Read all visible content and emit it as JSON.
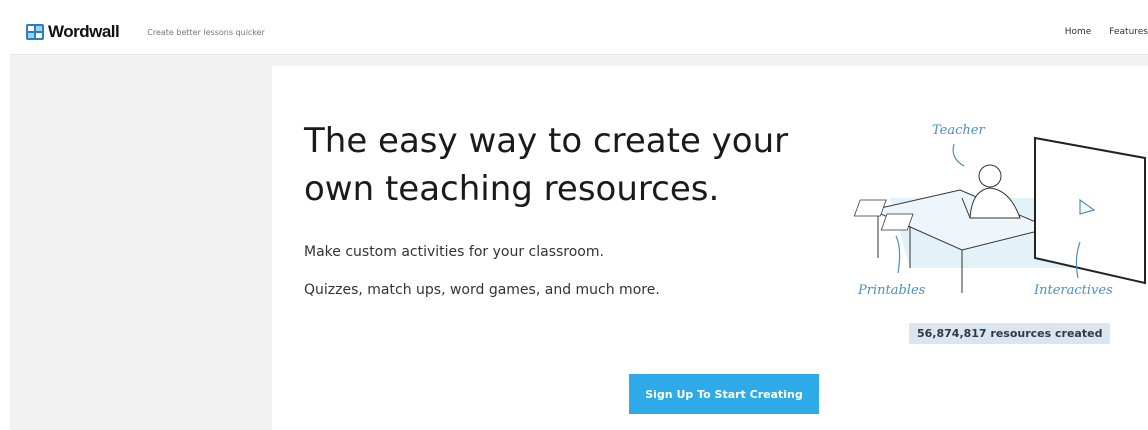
{
  "header": {
    "logo_text": "Wordwall",
    "tagline": "Create better lessons quicker",
    "nav": [
      "Home",
      "Features"
    ]
  },
  "hero": {
    "headline_line1": "The easy way to create your",
    "headline_line2": "own teaching resources.",
    "subtitle_1": "Make custom activities for your classroom.",
    "subtitle_2": "Quizzes, match ups, word games, and much more.",
    "cta_label": "Sign Up To Start Creating"
  },
  "illustration": {
    "label_teacher": "Teacher",
    "label_printables": "Printables",
    "label_interactives": "Interactives"
  },
  "stats": {
    "resources_created": "56,874,817 resources created"
  },
  "colors": {
    "accent": "#2eaae9",
    "badge_bg": "#dbe5ee",
    "script_blue": "#4a8fc0"
  }
}
